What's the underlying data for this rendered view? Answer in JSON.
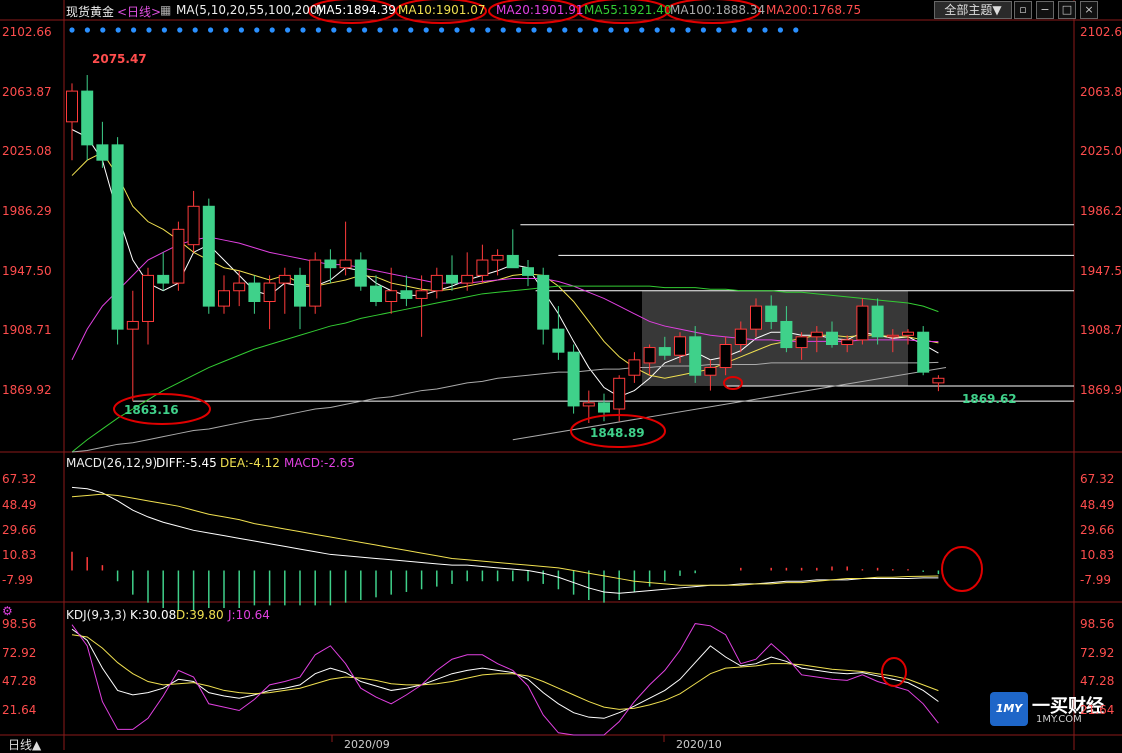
{
  "header": {
    "instrument": "现货黄金",
    "period": "<日线>",
    "ma_params": "MA(5,10,20,55,100,200)",
    "ma5": "MA5:1894.39",
    "ma10": "MA10:1901.07",
    "ma20": "MA20:1901.91",
    "ma55": "MA55:1921.40",
    "ma100": "MA100:1888.34",
    "ma200": "MA200:1768.75",
    "theme_button": "全部主题▼"
  },
  "macd_header": {
    "params": "MACD(26,12,9)",
    "diff": "DIFF:-5.45",
    "dea": "DEA:-4.12",
    "macd": "MACD:-2.65"
  },
  "kdj_header": {
    "params": "KDJ(9,3,3)",
    "k": "K:30.08",
    "d": "D:39.80",
    "j": "J:10.64"
  },
  "annotations": {
    "high": "2075.47",
    "low1": "1863.16",
    "low2": "1848.89",
    "last_low": "1869.62"
  },
  "x_labels": [
    "2020/09",
    "2020/10"
  ],
  "footer": {
    "period_tab": "日线▲",
    "logo_text": "一买财经",
    "logo_url": "1MY.COM",
    "logo_mark": "1MY"
  },
  "colors": {
    "up": "#ff3b3b",
    "down": "#3fd18a",
    "ma5": "#ffffff",
    "ma10": "#f0e050",
    "ma20": "#e040e0",
    "ma55": "#33cc33",
    "ma100": "#aaaaaa",
    "axis": "#ff4d4d",
    "circle": "#e00000"
  },
  "chart_data": [
    {
      "type": "candlestick",
      "name": "现货黄金 日线",
      "y_ticks": [
        2102.66,
        2063.87,
        2025.08,
        1986.29,
        1947.5,
        1908.71,
        1869.92
      ],
      "ylim": [
        1830,
        2110
      ],
      "ohlc": [
        [
          2045,
          2070,
          2020,
          2065
        ],
        [
          2065,
          2075.47,
          2020,
          2030
        ],
        [
          2030,
          2045,
          2015,
          2020
        ],
        [
          2030,
          2035,
          1900,
          1910
        ],
        [
          1910,
          1935,
          1863.16,
          1915
        ],
        [
          1915,
          1950,
          1900,
          1945
        ],
        [
          1945,
          1960,
          1935,
          1940
        ],
        [
          1940,
          1980,
          1935,
          1975
        ],
        [
          1965,
          2000,
          1960,
          1990
        ],
        [
          1990,
          1995,
          1920,
          1925
        ],
        [
          1925,
          1945,
          1920,
          1935
        ],
        [
          1935,
          1948,
          1925,
          1940
        ],
        [
          1940,
          1945,
          1920,
          1928
        ],
        [
          1928,
          1945,
          1910,
          1940
        ],
        [
          1940,
          1950,
          1920,
          1945
        ],
        [
          1945,
          1950,
          1910,
          1925
        ],
        [
          1925,
          1960,
          1920,
          1955
        ],
        [
          1955,
          1962,
          1940,
          1950
        ],
        [
          1950,
          1980,
          1945,
          1955
        ],
        [
          1955,
          1960,
          1935,
          1938
        ],
        [
          1938,
          1945,
          1925,
          1928
        ],
        [
          1928,
          1950,
          1920,
          1935
        ],
        [
          1935,
          1945,
          1925,
          1930
        ],
        [
          1930,
          1945,
          1905,
          1935
        ],
        [
          1935,
          1950,
          1930,
          1945
        ],
        [
          1945,
          1958,
          1935,
          1940
        ],
        [
          1940,
          1960,
          1935,
          1945
        ],
        [
          1945,
          1965,
          1940,
          1955
        ],
        [
          1955,
          1962,
          1945,
          1958
        ],
        [
          1958,
          1975,
          1950,
          1950
        ],
        [
          1950,
          1955,
          1938,
          1945
        ],
        [
          1945,
          1950,
          1900,
          1910
        ],
        [
          1910,
          1925,
          1890,
          1895
        ],
        [
          1895,
          1900,
          1855,
          1860
        ],
        [
          1860,
          1870,
          1848.89,
          1862
        ],
        [
          1862,
          1868,
          1850,
          1856
        ],
        [
          1858,
          1880,
          1850,
          1878
        ],
        [
          1880,
          1895,
          1875,
          1890
        ],
        [
          1888,
          1900,
          1880,
          1898
        ],
        [
          1898,
          1905,
          1890,
          1893
        ],
        [
          1893,
          1908,
          1888,
          1905
        ],
        [
          1905,
          1912,
          1875,
          1880
        ],
        [
          1880,
          1890,
          1870,
          1885
        ],
        [
          1885,
          1905,
          1880,
          1900
        ],
        [
          1900,
          1915,
          1895,
          1910
        ],
        [
          1910,
          1930,
          1905,
          1925
        ],
        [
          1925,
          1932,
          1910,
          1915
        ],
        [
          1915,
          1925,
          1895,
          1898
        ],
        [
          1898,
          1908,
          1890,
          1905
        ],
        [
          1905,
          1912,
          1895,
          1908
        ],
        [
          1908,
          1915,
          1898,
          1900
        ],
        [
          1900,
          1906,
          1895,
          1903
        ],
        [
          1903,
          1930,
          1900,
          1925
        ],
        [
          1925,
          1930,
          1900,
          1905
        ],
        [
          1905,
          1910,
          1895,
          1906
        ],
        [
          1906,
          1910,
          1900,
          1908
        ],
        [
          1908,
          1912,
          1880,
          1882
        ],
        [
          1875,
          1880,
          1869.62,
          1878
        ]
      ],
      "moving_averages": {
        "MA5": [
          2040,
          2035,
          2020,
          1985,
          1955,
          1940,
          1935,
          1940,
          1960,
          1965,
          1955,
          1945,
          1935,
          1932,
          1940,
          1938,
          1938,
          1942,
          1950,
          1948,
          1940,
          1935,
          1932,
          1932,
          1935,
          1938,
          1942,
          1945,
          1948,
          1952,
          1950,
          1935,
          1920,
          1902,
          1885,
          1872,
          1866,
          1870,
          1878,
          1888,
          1892,
          1895,
          1890,
          1892,
          1896,
          1904,
          1908,
          1908,
          1906,
          1906,
          1904,
          1903,
          1908,
          1906,
          1904,
          1905,
          1900,
          1894.39
        ],
        "MA10": [
          2010,
          2020,
          2025,
          2010,
          1990,
          1980,
          1975,
          1968,
          1960,
          1955,
          1950,
          1948,
          1945,
          1942,
          1945,
          1940,
          1938,
          1940,
          1942,
          1945,
          1944,
          1940,
          1938,
          1936,
          1935,
          1936,
          1938,
          1940,
          1942,
          1945,
          1946,
          1945,
          1938,
          1928,
          1915,
          1902,
          1892,
          1885,
          1880,
          1878,
          1880,
          1882,
          1884,
          1888,
          1892,
          1896,
          1900,
          1902,
          1904,
          1906,
          1906,
          1905,
          1906,
          1906,
          1905,
          1905,
          1903,
          1901.07
        ],
        "MA20": [
          1890,
          1910,
          1925,
          1935,
          1945,
          1955,
          1960,
          1965,
          1968,
          1970,
          1968,
          1966,
          1963,
          1960,
          1958,
          1956,
          1954,
          1952,
          1952,
          1950,
          1948,
          1946,
          1944,
          1942,
          1940,
          1940,
          1940,
          1941,
          1942,
          1943,
          1943,
          1943,
          1941,
          1938,
          1934,
          1930,
          1925,
          1920,
          1915,
          1912,
          1910,
          1908,
          1906,
          1905,
          1904,
          1903,
          1903,
          1902,
          1902,
          1902,
          1902,
          1902,
          1903,
          1903,
          1903,
          1903,
          1902,
          1901.91
        ],
        "MA55": [
          1830,
          1838,
          1845,
          1852,
          1858,
          1864,
          1870,
          1875,
          1880,
          1885,
          1889,
          1893,
          1897,
          1900,
          1903,
          1906,
          1909,
          1912,
          1914,
          1917,
          1919,
          1921,
          1923,
          1925,
          1927,
          1929,
          1931,
          1933,
          1934,
          1935,
          1936,
          1937,
          1938,
          1938,
          1938,
          1938,
          1938,
          1938,
          1938,
          1937,
          1937,
          1937,
          1936,
          1936,
          1935,
          1935,
          1935,
          1934,
          1934,
          1933,
          1932,
          1931,
          1930,
          1929,
          1928,
          1927,
          1925,
          1921.4
        ],
        "MA100": [
          1830,
          1831,
          1833,
          1835,
          1836,
          1838,
          1840,
          1842,
          1844,
          1845,
          1847,
          1849,
          1851,
          1852,
          1854,
          1856,
          1858,
          1859,
          1861,
          1863,
          1865,
          1866,
          1868,
          1870,
          1871,
          1873,
          1875,
          1876,
          1878,
          1879,
          1880,
          1881,
          1882,
          1882,
          1883,
          1884,
          1884,
          1885,
          1885,
          1886,
          1886,
          1886,
          1887,
          1887,
          1887,
          1887,
          1888,
          1888,
          1888,
          1888,
          1888,
          1888,
          1888,
          1888,
          1888,
          1888,
          1888,
          1888.34
        ]
      }
    },
    {
      "type": "bar",
      "name": "MACD(26,12,9)",
      "y_ticks": [
        67.32,
        48.49,
        29.66,
        10.83,
        -7.99
      ],
      "ylim": [
        -22,
        75
      ],
      "DIFF": [
        62,
        61,
        58,
        52,
        45,
        40,
        36,
        33,
        30,
        28,
        26,
        24,
        22,
        20,
        18,
        16,
        14,
        12,
        11,
        10,
        9,
        8,
        7,
        6,
        5,
        4,
        4,
        3,
        2,
        1,
        0,
        -2,
        -5,
        -9,
        -13,
        -16,
        -17,
        -16,
        -15,
        -14,
        -13,
        -12,
        -11,
        -11,
        -10,
        -10,
        -9,
        -8,
        -8,
        -7,
        -7,
        -7,
        -6,
        -6,
        -6,
        -6,
        -5.5,
        -5.45
      ],
      "DEA": [
        55,
        56,
        57,
        56,
        54,
        52,
        50,
        48,
        45,
        42,
        40,
        38,
        35,
        33,
        31,
        29,
        27,
        25,
        23,
        21,
        19,
        17,
        15,
        13,
        11,
        9,
        8,
        7,
        6,
        5,
        4,
        3,
        2,
        0,
        -2,
        -4,
        -6,
        -8,
        -9,
        -10,
        -11,
        -11,
        -11,
        -11,
        -11,
        -10,
        -10,
        -9,
        -9,
        -8,
        -7,
        -6,
        -6,
        -5,
        -5,
        -4.5,
        -4.3,
        -4.12
      ],
      "MACD": [
        14,
        10,
        4,
        -8,
        -18,
        -24,
        -28,
        -30,
        -30,
        -28,
        -28,
        -28,
        -26,
        -26,
        -26,
        -26,
        -26,
        -26,
        -24,
        -22,
        -20,
        -18,
        -16,
        -14,
        -12,
        -10,
        -8,
        -8,
        -8,
        -8,
        -8,
        -10,
        -14,
        -18,
        -22,
        -24,
        -22,
        -16,
        -12,
        -8,
        -4,
        -2,
        0,
        0,
        2,
        0,
        2,
        2,
        2,
        2,
        3,
        3,
        1,
        2,
        1,
        1,
        -1,
        -2.65
      ]
    },
    {
      "type": "line",
      "name": "KDJ(9,3,3)",
      "y_ticks": [
        98.56,
        72.92,
        47.28,
        21.64
      ],
      "ylim": [
        0,
        105
      ],
      "K": [
        95,
        85,
        60,
        40,
        36,
        38,
        42,
        50,
        48,
        38,
        35,
        33,
        36,
        40,
        42,
        45,
        55,
        60,
        56,
        48,
        44,
        40,
        42,
        45,
        50,
        55,
        58,
        60,
        58,
        56,
        50,
        38,
        28,
        20,
        16,
        15,
        20,
        26,
        33,
        40,
        50,
        65,
        80,
        70,
        62,
        64,
        70,
        66,
        60,
        58,
        56,
        55,
        56,
        53,
        50,
        47,
        40,
        30.08
      ],
      "D": [
        90,
        88,
        78,
        65,
        55,
        48,
        45,
        46,
        47,
        44,
        40,
        38,
        37,
        38,
        40,
        42,
        46,
        50,
        52,
        51,
        49,
        46,
        45,
        45,
        46,
        48,
        51,
        54,
        55,
        55,
        53,
        48,
        42,
        36,
        30,
        25,
        23,
        24,
        27,
        31,
        37,
        46,
        55,
        60,
        61,
        62,
        64,
        64,
        63,
        61,
        59,
        58,
        57,
        55,
        53,
        50,
        45,
        39.8
      ],
      "J": [
        99,
        80,
        30,
        5,
        5,
        15,
        35,
        58,
        52,
        28,
        25,
        22,
        32,
        45,
        48,
        52,
        72,
        80,
        64,
        42,
        34,
        28,
        36,
        45,
        58,
        68,
        72,
        72,
        64,
        58,
        44,
        18,
        2,
        0,
        0,
        0,
        12,
        30,
        45,
        58,
        76,
        100,
        98,
        90,
        64,
        68,
        82,
        70,
        54,
        52,
        50,
        49,
        54,
        48,
        44,
        40,
        28,
        10.64
      ]
    }
  ]
}
